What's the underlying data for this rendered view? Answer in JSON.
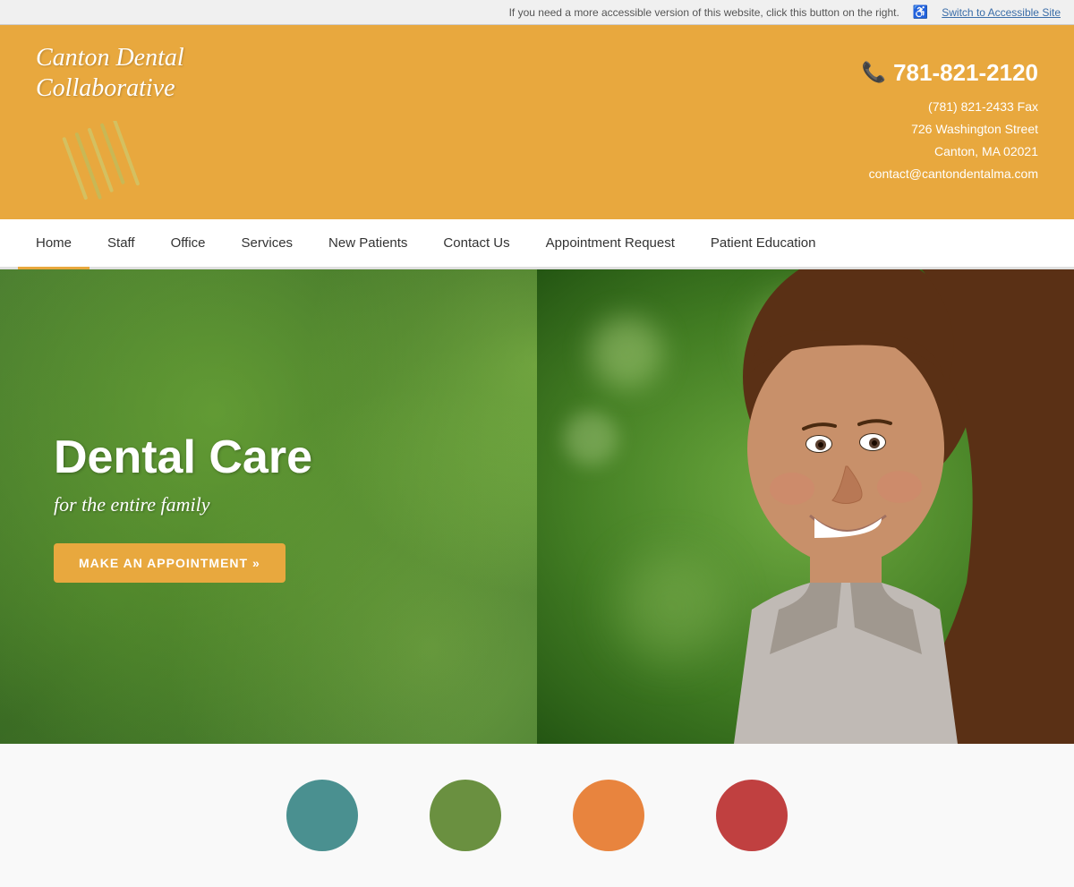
{
  "accessibility_bar": {
    "message": "If you need a more accessible version of this website, click this button on the right.",
    "link_text": "Switch to Accessible Site"
  },
  "header": {
    "logo_line1": "Canton Dental",
    "logo_line2": "Collaborative",
    "phone": "781-821-2120",
    "fax": "(781) 821-2433 Fax",
    "address1": "726 Washington Street",
    "address2": "Canton, MA 02021",
    "email": "contact@cantondentalma.com"
  },
  "nav": {
    "items": [
      {
        "label": "Home",
        "active": true
      },
      {
        "label": "Staff",
        "active": false
      },
      {
        "label": "Office",
        "active": false
      },
      {
        "label": "Services",
        "active": false
      },
      {
        "label": "New Patients",
        "active": false
      },
      {
        "label": "Contact Us",
        "active": false
      },
      {
        "label": "Appointment Request",
        "active": false
      },
      {
        "label": "Patient Education",
        "active": false
      }
    ]
  },
  "hero": {
    "title": "Dental Care",
    "subtitle": "for the entire family",
    "cta_label": "MAKE AN APPOINTMENT »"
  },
  "bottom_circles": [
    {
      "color": "teal"
    },
    {
      "color": "green"
    },
    {
      "color": "orange"
    },
    {
      "color": "red"
    }
  ]
}
